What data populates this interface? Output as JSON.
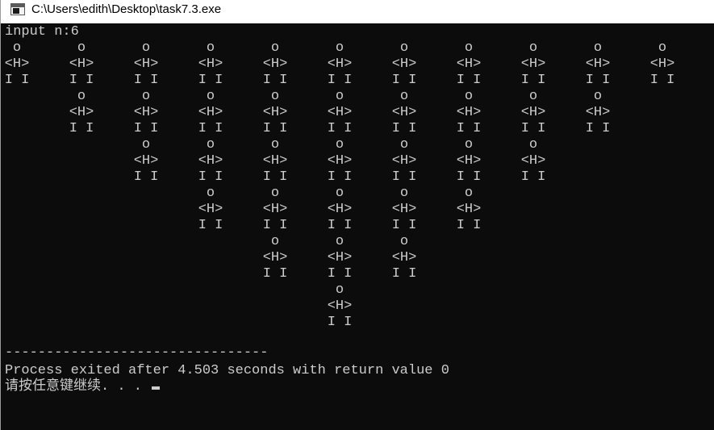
{
  "window": {
    "title": "C:\\Users\\edith\\Desktop\\task7.3.exe"
  },
  "console": {
    "prompt_line": "input n:6",
    "figure": {
      "head": "o",
      "body": "<H>",
      "legs": "I I"
    },
    "column_heights": [
      1,
      2,
      3,
      4,
      5,
      6,
      5,
      4,
      3,
      2,
      1
    ],
    "separator": "--------------------------------",
    "exit_line": "Process exited after 4.503 seconds with return value 0",
    "continue_line": "请按任意键继续. . . "
  },
  "colors": {
    "console_bg": "#0c0c0c",
    "console_text": "#cccccc",
    "titlebar_bg": "#ffffff"
  }
}
